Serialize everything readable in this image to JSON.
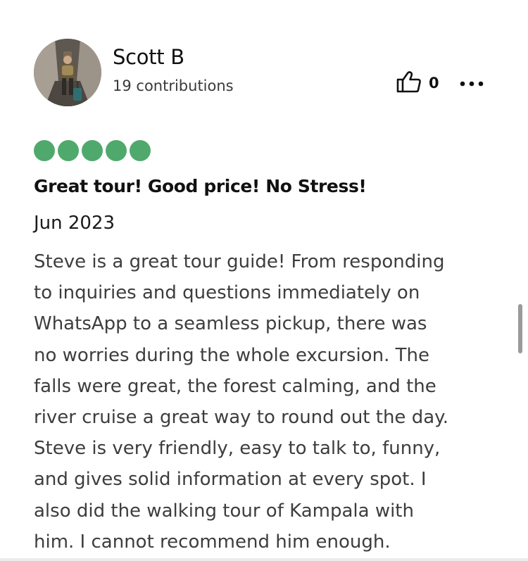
{
  "author": {
    "name": "Scott B",
    "contributions": "19 contributions"
  },
  "helpful": {
    "count": "0"
  },
  "rating": {
    "value": 5,
    "max": 5,
    "color": "#50a96c"
  },
  "review": {
    "title": "Great tour! Good price! No Stress!",
    "date": "Jun 2023",
    "body": "Steve is a great tour guide! From responding\nto inquiries and questions immediately on\nWhatsApp to a seamless pickup, there was\nno worries during the whole excursion. The\nfalls were great, the forest calming, and the\nriver cruise a great way to round out the day.\nSteve is very friendly, easy to talk to, funny,\nand gives solid information at every spot. I\nalso did the walking tour of Kampala with\nhim. I cannot recommend him enough."
  },
  "icons": {
    "helpful": "thumbs-up-icon",
    "more": "more-options-icon"
  }
}
